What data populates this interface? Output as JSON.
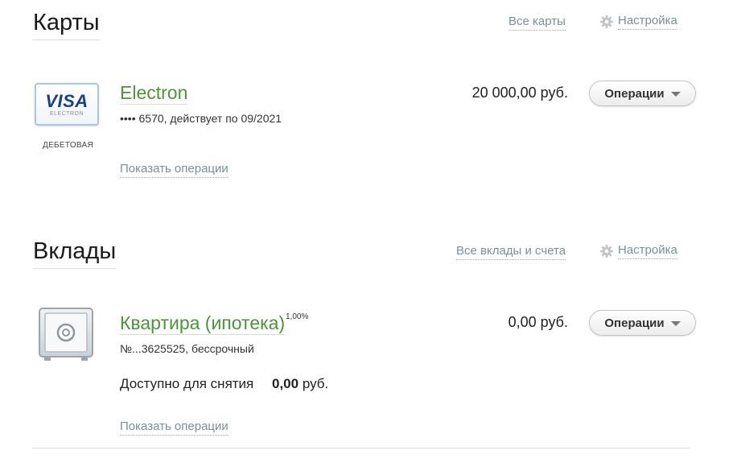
{
  "cards": {
    "title": "Карты",
    "all_link": "Все карты",
    "settings_label": "Настройка",
    "item": {
      "brand": "VISA",
      "brand_sub": "ELECTRON",
      "type_label": "ДЕБЕТОВАЯ",
      "name": "Electron",
      "details": "•••• 6570, действует по 09/2021",
      "amount": "20 000,00 руб.",
      "operations_label": "Операции",
      "show_operations": "Показать операции"
    }
  },
  "deposits": {
    "title": "Вклады",
    "all_link": "Все вклады и счета",
    "settings_label": "Настройка",
    "item": {
      "name": "Квартира (ипотека)",
      "rate": "1,00%",
      "details": "№...3625525, бессрочный",
      "amount": "0,00 руб.",
      "operations_label": "Операции",
      "available_label": "Доступно для снятия",
      "available_value": "0,00",
      "available_currency": "руб.",
      "show_operations": "Показать операции"
    }
  },
  "colors": {
    "accent_green": "#4a9636",
    "link_gray": "#7a8f9a",
    "visa_blue": "#1b3f8f"
  }
}
